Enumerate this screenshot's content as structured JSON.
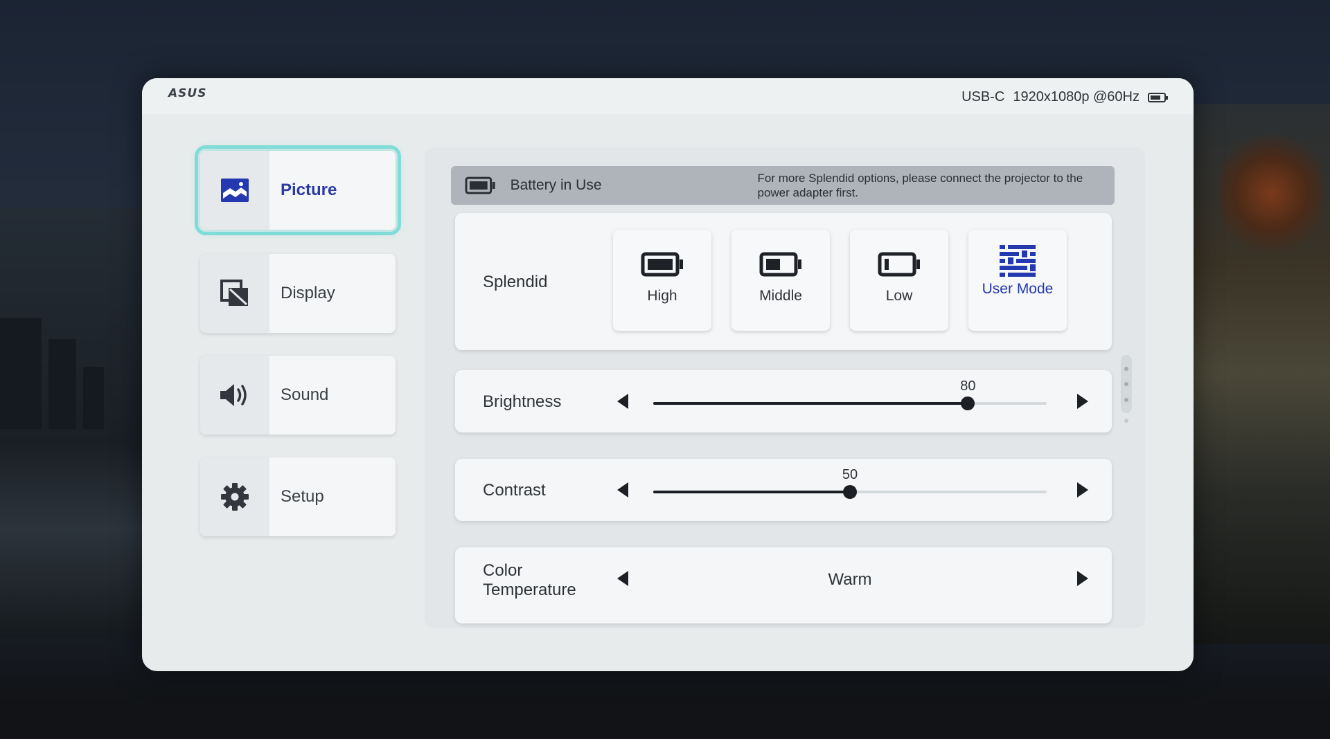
{
  "brand": "ASUS",
  "status": {
    "source": "USB-C",
    "resolution": "1920x1080p @60Hz",
    "battery_icon": "battery-icon"
  },
  "menu": {
    "items": [
      {
        "label": "Picture",
        "icon": "picture-icon",
        "active": true
      },
      {
        "label": "Display",
        "icon": "display-icon",
        "active": false
      },
      {
        "label": "Sound",
        "icon": "speaker-icon",
        "active": false
      },
      {
        "label": "Setup",
        "icon": "gear-icon",
        "active": false
      }
    ]
  },
  "notice": {
    "title": "Battery in Use",
    "text": "For more Splendid options, please connect the projector to the power adapter first."
  },
  "splendid": {
    "label": "Splendid",
    "modes": [
      {
        "label": "High",
        "icon": "battery-high-icon",
        "selected": false
      },
      {
        "label": "Middle",
        "icon": "battery-middle-icon",
        "selected": false
      },
      {
        "label": "Low",
        "icon": "battery-low-icon",
        "selected": false
      },
      {
        "label": "User Mode",
        "icon": "user-mode-icon",
        "selected": true
      }
    ]
  },
  "brightness": {
    "label": "Brightness",
    "value": "80",
    "level": 80,
    "min": 0,
    "max": 100
  },
  "contrast": {
    "label": "Contrast",
    "value": "50",
    "level": 50,
    "min": 0,
    "max": 100
  },
  "color_temperature": {
    "label": "Color Temperature",
    "value": "Warm"
  },
  "colors": {
    "accent": "#2438b0",
    "selection_outline": "#7fdcd6",
    "notice_bg": "#aeb4ba"
  }
}
